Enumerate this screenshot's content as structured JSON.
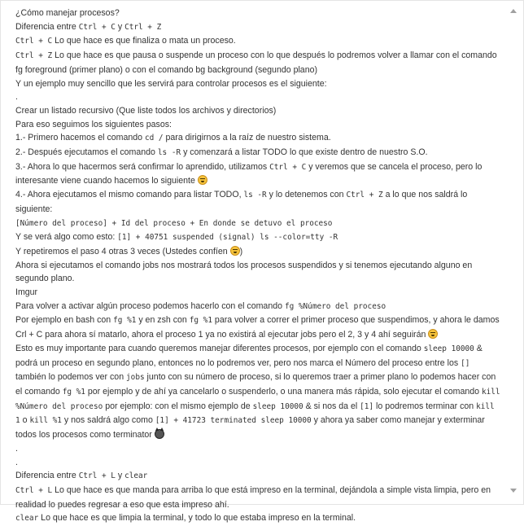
{
  "lines": [
    [
      "¿Cómo manejar procesos?"
    ],
    [
      "Diferencia entre ",
      {
        "code": "Ctrl + C"
      },
      " y ",
      {
        "code": "Ctrl + Z"
      }
    ],
    [
      {
        "code": "Ctrl + C"
      },
      " Lo que hace es que finaliza o mata un proceso."
    ],
    [
      {
        "code": "Ctrl + Z"
      },
      " Lo que hace es que pausa o suspende un proceso con lo que después lo podremos volver a llamar con el comando fg foreground (primer plano) o con el comando bg background (segundo plano)"
    ],
    [
      "Y un ejemplo muy sencillo que les servirá para controlar procesos es el siguiente:"
    ],
    [
      "."
    ],
    [
      "Crear un listado recursivo (Que liste todos los archivos y directorios)"
    ],
    [
      "Para eso seguimos los siguientes pasos:"
    ],
    [
      "1.- Primero hacemos el comando ",
      {
        "code": "cd /"
      },
      " para dirigirnos a la raíz de nuestro sistema."
    ],
    [
      "2.- Después ejecutamos el comando ",
      {
        "code": "ls -R"
      },
      " y comenzará a listar TODO lo que existe dentro de nuestro S.O."
    ],
    [
      "3.- Ahora lo que hacermos será confirmar lo aprendido, utilizamos ",
      {
        "code": "Ctrl + C"
      },
      " y veremos que se cancela el proceso, pero lo interesante viene cuando hacemos lo siguiente ",
      {
        "emoji": "grin"
      }
    ],
    [
      "4.- Ahora ejecutamos el mismo comando para listar TODO, ",
      {
        "code": "ls -R"
      },
      " y lo detenemos con ",
      {
        "code": "Ctrl + Z"
      },
      " a lo que nos saldrá lo siguiente:"
    ],
    [
      {
        "code": "[Número del proceso] + Id del proceso + En donde se detuvo el proceso"
      }
    ],
    [
      "Y se verá algo como esto: ",
      {
        "code": "[1] + 40751 suspended (signal) ls --color=tty -R"
      }
    ],
    [
      "Y repetiremos el paso 4 otras 3 veces (Ustedes confíen ",
      {
        "emoji": "grin"
      },
      ")"
    ],
    [
      "Ahora si ejecutamos el comando jobs nos mostrará todos los procesos suspendidos y si tenemos ejecutando alguno en segundo plano."
    ],
    [
      "Imgur"
    ],
    [
      "Para volver a activar algún proceso podemos hacerlo con el comando ",
      {
        "code": "fg %Número del proceso"
      }
    ],
    [
      "Por ejemplo en bash con ",
      {
        "code": "fg %1"
      },
      " y en zsh con ",
      {
        "code": "fg %1"
      },
      " para volver a correr el primer proceso que suspendimos, y ahora le damos Crl + C para ahora sí matarlo, ahora el proceso 1 ya no existirá al ejecutar jobs pero el 2, 3 y 4 ahí seguirán ",
      {
        "emoji": "grin"
      }
    ],
    [
      "Esto es muy importante para cuando queremos manejar diferentes procesos, por ejemplo con el comando ",
      {
        "code": "sleep 10000"
      },
      " & podrá un proceso en segundo plano, entonces no lo podremos ver, pero nos marca el Número del proceso entre los ",
      {
        "code": "[]"
      },
      " también lo podemos ver con ",
      {
        "code": "jobs"
      },
      " junto con su número de proceso, si lo queremos traer a primer plano lo podemos hacer con el comando ",
      {
        "code": "fg %1"
      },
      " por ejemplo y de ahí ya cancelarlo o suspenderlo, o una manera más rápida, solo ejecutar el comando ",
      {
        "code": "kill %Número del proceso"
      },
      " por ejemplo: con el mismo ejemplo de ",
      {
        "code": "sleep 10000"
      },
      " & si nos da el ",
      {
        "code": "[1]"
      },
      " lo podremos terminar con ",
      {
        "code": "kill 1"
      },
      " o ",
      {
        "code": "kill %1"
      },
      " y nos saldrá algo como ",
      {
        "code": "[1] + 41723 terminated sleep 10000"
      },
      " y ahora ya saber como manejar y exterminar todos los procesos como terminator ",
      {
        "emoji": "devil"
      }
    ],
    [
      "."
    ],
    [
      "."
    ],
    [
      "Diferencia entre ",
      {
        "code": "Ctrl + L"
      },
      " y ",
      {
        "code": "clear"
      }
    ],
    [
      {
        "code": "Ctrl + L"
      },
      " Lo que hace es que manda para arriba lo que está impreso en la terminal, dejándola a simple vista limpia, pero en realidad lo puedes regresar a eso que esta impreso ahí."
    ],
    [
      {
        "code": "clear"
      },
      " Lo que hace es que limpia la terminal, y todo lo que estaba impreso en la terminal."
    ]
  ],
  "line_names": [
    "heading-question",
    "heading-difference-ctrl-c-z",
    "paragraph-ctrl-c",
    "paragraph-ctrl-z",
    "paragraph-example-intro",
    "separator-dot",
    "paragraph-recursive-list",
    "paragraph-steps-intro",
    "step-1",
    "step-2",
    "step-3",
    "step-4",
    "code-process-format",
    "paragraph-output-example",
    "paragraph-repeat-step",
    "paragraph-jobs",
    "image-placeholder-imgur",
    "paragraph-fg-command",
    "paragraph-fg-example",
    "paragraph-sleep-kill",
    "separator-dot",
    "separator-dot",
    "heading-difference-ctrl-l-clear",
    "paragraph-ctrl-l",
    "paragraph-clear"
  ]
}
